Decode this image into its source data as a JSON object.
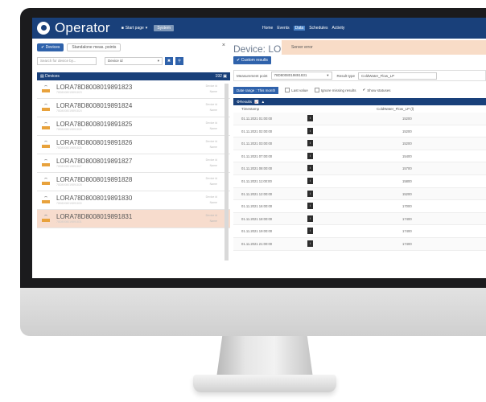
{
  "topbar": {
    "app_name": "Operator",
    "start_page": "Start page",
    "system_badge": "System",
    "nav": [
      "Home",
      "Events",
      "Data",
      "Schedules",
      "Activity"
    ],
    "active_nav": "Data"
  },
  "left_panel": {
    "tab_devices": "Devices",
    "tab_standalone": "Standalone meas. points",
    "close_icon": "close-icon",
    "search_placeholder": "Search for device by...",
    "search_field_select": "Device id",
    "devices_header": "Devices",
    "devices_count": "192",
    "devices": [
      {
        "name": "LORA78D8008019891823",
        "sub": "78D8008019891823",
        "meta1": "Device id",
        "meta2": "Name"
      },
      {
        "name": "LORA78D8008019891824",
        "sub": "78D8008019891824",
        "meta1": "Device id",
        "meta2": "Name"
      },
      {
        "name": "LORA78D8008019891825",
        "sub": "78D8008019891825",
        "meta1": "Device id",
        "meta2": "Name"
      },
      {
        "name": "LORA78D8008019891826",
        "sub": "78D8008019891826",
        "meta1": "Device id",
        "meta2": "Name"
      },
      {
        "name": "LORA78D8008019891827",
        "sub": "78D8008019891827",
        "meta1": "Device id",
        "meta2": "Name"
      },
      {
        "name": "LORA78D8008019891828",
        "sub": "78D8008019891828",
        "meta1": "Device id",
        "meta2": "Name"
      },
      {
        "name": "LORA78D8008019891830",
        "sub": "78D8008019891830",
        "meta1": "Device id",
        "meta2": "Name"
      },
      {
        "name": "LORA78D8008019891831",
        "sub": "78D8008019891831",
        "meta1": "Device id",
        "meta2": "Name"
      }
    ],
    "selected_index": 7
  },
  "right_panel": {
    "device_title": "Device: LO",
    "banner_text": "Server error",
    "custom_results_button": "Custom results",
    "measurement_point_label": "Measurement point",
    "measurement_point_value": "78D8008019891831",
    "result_type_label": "Result type",
    "result_type_value": "ColdWater_Flow_LP",
    "date_range_button": "Date range : This month",
    "last_value_label": "Last value",
    "ignore_missing_label": "Ignore missing results",
    "show_statuses_label": "Show statuses",
    "results_label": "Results",
    "col_timestamp": "Timestamp",
    "col_value": "ColdWater_Flow_LP (l)",
    "rows": [
      {
        "timestamp": "01.11.2021 01:00:00",
        "value": "15200"
      },
      {
        "timestamp": "01.11.2021 02:00:00",
        "value": "15200"
      },
      {
        "timestamp": "01.11.2021 03:00:00",
        "value": "15200"
      },
      {
        "timestamp": "01.11.2021 07:00:00",
        "value": "15400"
      },
      {
        "timestamp": "01.11.2021 08:00:00",
        "value": "15700"
      },
      {
        "timestamp": "01.11.2021 11:00:00",
        "value": "15800"
      },
      {
        "timestamp": "01.11.2021 12:00:00",
        "value": "15200"
      },
      {
        "timestamp": "01.11.2021 16:00:00",
        "value": "17000"
      },
      {
        "timestamp": "01.11.2021 18:00:00",
        "value": "17400"
      },
      {
        "timestamp": "01.11.2021 19:00:00",
        "value": "17400"
      },
      {
        "timestamp": "01.11.2021 21:00:00",
        "value": "17400"
      }
    ]
  }
}
